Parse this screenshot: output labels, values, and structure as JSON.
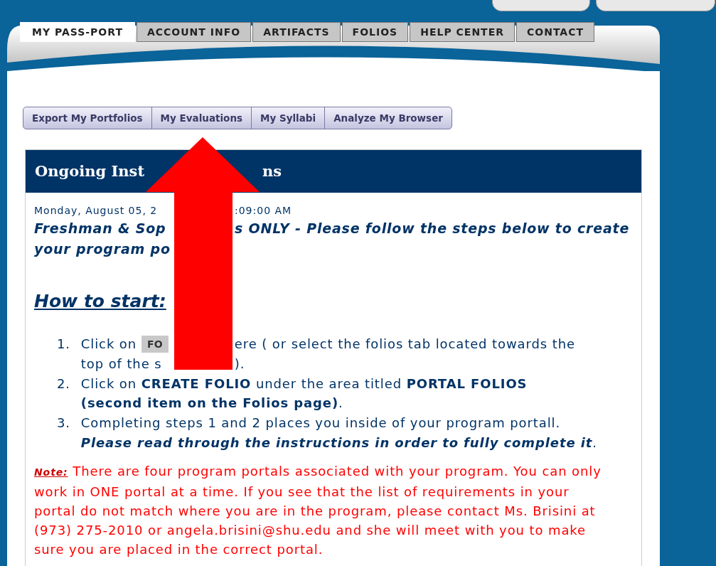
{
  "nav_tabs": [
    {
      "label": "MY PASS-PORT",
      "selected": true
    },
    {
      "label": "ACCOUNT INFO",
      "selected": false
    },
    {
      "label": "ARTIFACTS",
      "selected": false
    },
    {
      "label": "FOLIOS",
      "selected": false
    },
    {
      "label": "HELP CENTER",
      "selected": false
    },
    {
      "label": "CONTACT",
      "selected": false
    }
  ],
  "sub_tabs": [
    {
      "label": "Export My Portfolios",
      "selected": false
    },
    {
      "label": "My Evaluations",
      "selected": false
    },
    {
      "label": "My Syllabi",
      "selected": false
    },
    {
      "label": "Analyze My Browser",
      "selected": false
    }
  ],
  "panel": {
    "title": {
      "before": "Ongoing Inst",
      "after": "ns"
    },
    "date": {
      "before": "Monday, August 05, 2",
      "after": ":09:00 AM"
    },
    "headline": [
      {
        "before": "Freshman & Sop",
        "after": "s ONLY - Please follow the steps below to create"
      },
      {
        "before": "your program po"
      }
    ],
    "heading": "How to start:",
    "steps": [
      {
        "number": "1.",
        "kind": "split",
        "lines": [
          {
            "before": "Click on",
            "button": "FO",
            "after": "ere ( or select the folios tab located towards the"
          },
          {
            "before": "top of the s",
            "after": ")."
          }
        ]
      },
      {
        "number": "2.",
        "kind": "rich",
        "text": "Click on **CREATE FOLIO** under the area titled **PORTAL FOLIOS (second item on the Folios page)**."
      },
      {
        "number": "3.",
        "kind": "emphasis",
        "text": "Completing steps 1 and 2 places you inside of your program portall.",
        "emphasis": "Please read through the instructions in order to fully complete it",
        "tail": "."
      }
    ],
    "note": {
      "label": "Note:",
      "text": "There are four program portals associated with your program. You can only work in ONE portal at a time. If you see that the list of requirements in your portal do not match where you are in the program, please contact Ms. Brisini at (973) 275-2010 or angela.brisini@shu.edu and she will meet with you to make sure you are placed in the correct portal."
    }
  }
}
